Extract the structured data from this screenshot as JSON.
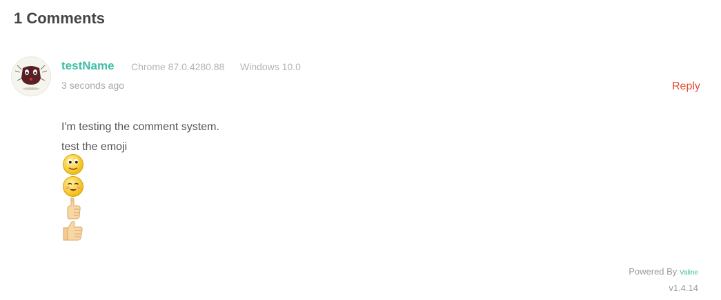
{
  "comments": {
    "count_title": "1 Comments",
    "items": [
      {
        "author": "testName",
        "browser": "Chrome 87.0.4280.88",
        "os": "Windows 10.0",
        "time": "3 seconds ago",
        "reply_label": "Reply",
        "lines": [
          "I'm testing the comment system.",
          "test the emoji"
        ],
        "emojis": [
          "wide-eyed-smiley",
          "blushing-smiley",
          "thumb-up",
          "thumbs-up"
        ]
      }
    ]
  },
  "footer": {
    "powered_by": "Powered By",
    "brand": "Valine",
    "version": "v1.4.14"
  },
  "colors": {
    "author": "#3fbfa4",
    "reply": "#e64a32",
    "meta": "#b3b3b3"
  }
}
